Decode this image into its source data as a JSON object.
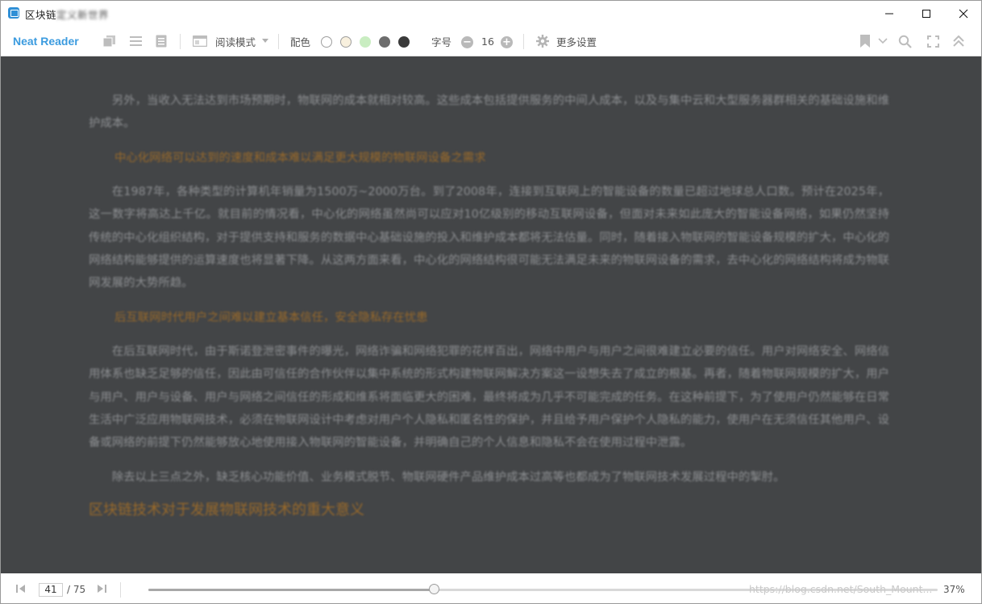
{
  "window": {
    "title_prefix": "区块链",
    "title_rest": "定义新世界",
    "minimize_glyph": "—",
    "maximize_glyph": "☐",
    "close_glyph": "✕"
  },
  "toolbar": {
    "brand": "Neat Reader",
    "reading_mode_label": "阅读模式",
    "color_label": "配色",
    "font_size_label": "字号",
    "font_size_value": "16",
    "more_settings_label": "更多设置",
    "decrease_glyph": "−",
    "increase_glyph": "+",
    "color_swatches": [
      "#ffffff",
      "#f8f0de",
      "#c9edc1",
      "#6d6d6d",
      "#3a3a3a"
    ]
  },
  "content": {
    "paragraph_1": "另外，当收入无法达到市场预期时，物联网的成本就相对较高。这些成本包括提供服务的中间人成本，以及与集中云和大型服务器群相关的基础设施和维护成本。",
    "subheading_1": "中心化网络可以达到的速度和成本难以满足更大规模的物联网设备之需求",
    "paragraph_2": "在1987年，各种类型的计算机年销量为1500万~2000万台。到了2008年，连接到互联网上的智能设备的数量已超过地球总人口数。预计在2025年，这一数字将高达上千亿。就目前的情况看，中心化的网络虽然尚可以应对10亿级别的移动互联网设备，但面对未来如此庞大的智能设备网络，如果仍然坚持传统的中心化组织结构，对于提供支持和服务的数据中心基础设施的投入和维护成本都将无法估量。同时，随着接入物联网的智能设备规模的扩大，中心化的网络结构能够提供的运算速度也将显著下降。从这两方面来看，中心化的网络结构很可能无法满足未来的物联网设备的需求，去中心化的网络结构将成为物联网发展的大势所趋。",
    "subheading_2": "后互联网时代用户之间难以建立基本信任，安全隐私存在忧患",
    "paragraph_3": "在后互联网时代，由于斯诺登泄密事件的曝光，网络诈骗和网络犯罪的花样百出，网络中用户与用户之间很难建立必要的信任。用户对网络安全、网络信用体系也缺乏足够的信任，因此由可信任的合作伙伴以集中系统的形式构建物联网解决方案这一设想失去了成立的根基。再者，随着物联网规模的扩大，用户与用户、用户与设备、用户与网络之间信任的形成和维系将面临更大的困难，最终将成为几乎不可能完成的任务。在这种前提下，为了使用户仍然能够在日常生活中广泛应用物联网技术，必须在物联网设计中考虑对用户个人隐私和匿名性的保护，并且给予用户保护个人隐私的能力，使用户在无须信任其他用户、设备或网络的前提下仍然能够放心地使用接入物联网的智能设备，并明确自己的个人信息和隐私不会在使用过程中泄露。",
    "paragraph_4": "除去以上三点之外，缺乏核心功能价值、业务模式脱节、物联网硬件产品维护成本过高等也都成为了物联网技术发展过程中的掣肘。",
    "chapter_heading": "区块链技术对于发展物联网技术的重大意义"
  },
  "bottom": {
    "current_page": "41",
    "total_pages": "/ 75",
    "progress_percent": "37%",
    "progress_fraction": 0.362,
    "watermark": "https://blog.csdn.net/South_Mount..."
  }
}
